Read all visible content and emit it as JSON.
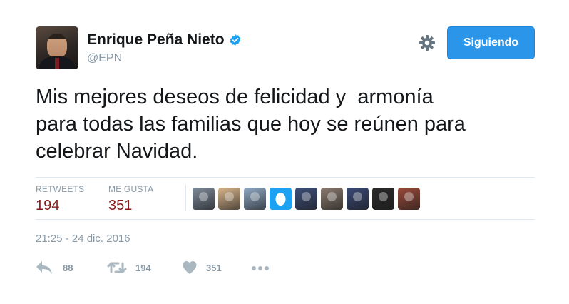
{
  "user": {
    "name": "Enrique Peña Nieto",
    "handle": "@EPN"
  },
  "header": {
    "follow_label": "Siguiendo"
  },
  "tweet": {
    "text": "Mis mejores deseos de felicidad y  armonía\npara todas las familias que hoy se reúnen para\ncelebrar Navidad."
  },
  "stats": {
    "retweets_label": "RETWEETS",
    "retweets_value": "194",
    "likes_label": "ME GUSTA",
    "likes_value": "351"
  },
  "likers": [
    {
      "icon": "eagle-avatar",
      "color": "#7e8a9a"
    },
    {
      "icon": "pattern-avatar",
      "color": "#d8b58a"
    },
    {
      "icon": "outdoor-avatar",
      "color": "#8fa9c4"
    },
    {
      "icon": "egg-avatar",
      "color": "#1da1f2"
    },
    {
      "icon": "person-avatar",
      "color": "#3d4f7a"
    },
    {
      "icon": "person-avatar",
      "color": "#8a7a6e"
    },
    {
      "icon": "stadium-avatar",
      "color": "#3a4a76"
    },
    {
      "icon": "person-avatar",
      "color": "#2a2a2a"
    },
    {
      "icon": "person-avatar",
      "color": "#9a4a3a"
    }
  ],
  "timestamp": "21:25 - 24 dic. 2016",
  "actions": {
    "reply_count": "88",
    "retweet_count": "194",
    "like_count": "351"
  },
  "colors": {
    "accent": "#2b95e9",
    "stat_value": "#8b1a1a",
    "muted": "#8899a6"
  }
}
